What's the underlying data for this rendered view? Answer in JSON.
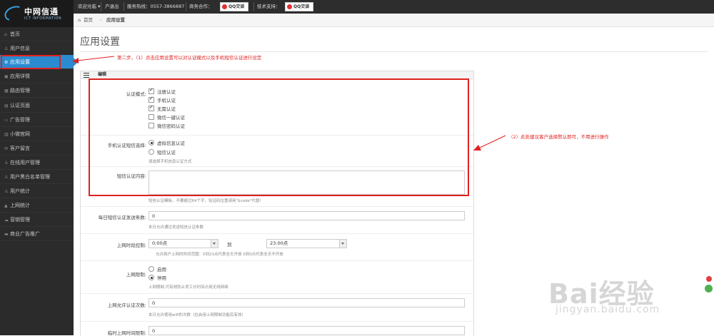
{
  "logo": {
    "name": "中网信通",
    "sub": "ICT INFORMATION"
  },
  "topbar": {
    "welcome": "欢迎光临 ▾",
    "logout": "户退出",
    "hotline": "服务热线：0557-3866887",
    "business": "商务合作：",
    "qq1": "QQ交谈",
    "support": "技术支持：",
    "qq2": "QQ交谈"
  },
  "breadcrumb": {
    "home": "首页",
    "sep": "›",
    "current": "应用设置"
  },
  "sidebar": {
    "items": [
      {
        "label": "首页",
        "icon": "home-icon",
        "glyph": "⌂"
      },
      {
        "label": "用户信息",
        "icon": "user-icon",
        "glyph": "♙"
      },
      {
        "label": "应用设置",
        "icon": "gear-icon",
        "glyph": "⚙"
      },
      {
        "label": "应用详情",
        "icon": "list-icon",
        "glyph": "▣"
      },
      {
        "label": "路由管理",
        "icon": "router-icon",
        "glyph": "▦"
      },
      {
        "label": "认证页面",
        "icon": "page-icon",
        "glyph": "▤"
      },
      {
        "label": "广告管理",
        "icon": "ad-icon",
        "glyph": "▭"
      },
      {
        "label": "小微官网",
        "icon": "site-icon",
        "glyph": "▥"
      },
      {
        "label": "客户留言",
        "icon": "message-icon",
        "glyph": "✉"
      },
      {
        "label": "在线用户管理",
        "icon": "online-user-icon",
        "glyph": "♙"
      },
      {
        "label": "用户黑白名单管理",
        "icon": "blacklist-icon",
        "glyph": "♙"
      },
      {
        "label": "用户统计",
        "icon": "stats-icon",
        "glyph": "♙"
      },
      {
        "label": "上网统计",
        "icon": "chart-icon",
        "glyph": "▲"
      },
      {
        "label": "营销管理",
        "icon": "marketing-icon",
        "glyph": "☁"
      },
      {
        "label": "商业广告推广",
        "icon": "promo-icon",
        "glyph": "▬"
      }
    ]
  },
  "page": {
    "title": "应用设置"
  },
  "panel": {
    "title": "编辑"
  },
  "form": {
    "auth_mode": {
      "label": "认证模式:",
      "options": [
        {
          "label": "注册认证",
          "checked": true
        },
        {
          "label": "手机认证",
          "checked": true
        },
        {
          "label": "无需认证",
          "checked": true
        },
        {
          "label": "微信一键认证",
          "checked": false
        },
        {
          "label": "微信密码认证",
          "checked": false
        }
      ]
    },
    "sms_choice": {
      "label": "手机认证短信选择:",
      "options": [
        {
          "label": "虚拟信息认证",
          "checked": true
        },
        {
          "label": "短信认证",
          "checked": false
        }
      ],
      "help": "请选择手机信息认证方式"
    },
    "sms_content": {
      "label": "短信认证内容:",
      "value": "",
      "help": "短信认证模板，不要超过64个字，验证码位置请用\"$code\"代替!"
    },
    "daily_limit": {
      "label": "每日短信认证发送条数:",
      "value": "0",
      "help": "本日允许通过发送短信认证条数"
    },
    "time_control": {
      "label": "上网时段控制:",
      "start": "0:00点",
      "to": "到",
      "end": "23:00点",
      "help": "允许用户上网的时间范围：0到23点代表全天开放 0到0点代表全天不开放"
    },
    "net_limit": {
      "label": "上网限制:",
      "options": [
        {
          "label": "启用",
          "checked": false
        },
        {
          "label": "停用",
          "checked": true
        }
      ],
      "help": "上网限制,可有效防止员工长时间占用无线网络"
    },
    "allowed_auth": {
      "label": "上网允许认证次数:",
      "value": "0",
      "help": "本日允许使用wifi的次数（在启用上网限制功能后有效）"
    },
    "temp_limit": {
      "label": "临时上网时间限制:",
      "value": "0"
    }
  },
  "annotations": {
    "step2": "第二步，（1）点击应用设置可以对认证模式以及手机短信认证进行设定",
    "note2": "（2）此处建议客户选择默认即可，不用进行操作"
  },
  "watermark": {
    "main": "Bai经验",
    "sub": "jingyan.baidu.com"
  },
  "colors": {
    "sidebar_bg": "#2b2b2b",
    "active": "#2a8bd0",
    "annotation": "#e02020"
  }
}
